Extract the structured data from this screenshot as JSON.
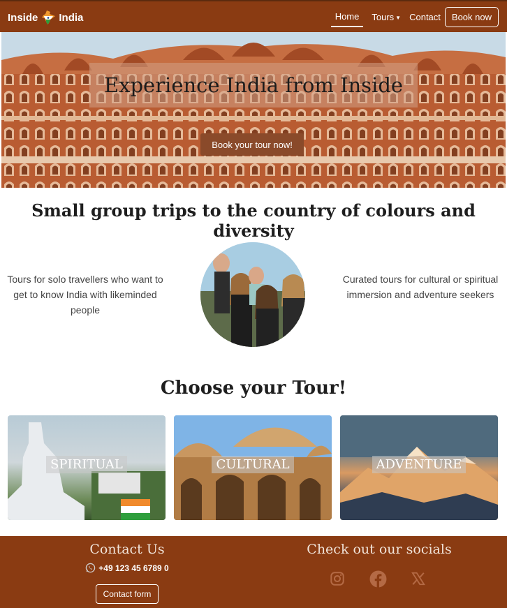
{
  "nav": {
    "brand_left": "Inside",
    "brand_right": "India",
    "links": [
      {
        "label": "Home"
      },
      {
        "label": "Tours"
      },
      {
        "label": "Contact"
      }
    ],
    "book_label": "Book now"
  },
  "hero": {
    "title": "Experience India from Inside",
    "cta": "Book your tour now!"
  },
  "intro": {
    "heading": "Small group trips to the country of colours and diversity",
    "left_text": "Tours for solo travellers who want to get to know India with likeminded people",
    "right_text": "Curated tours for cultural or spiritual immersion and adventure seekers"
  },
  "tours": {
    "heading": "Choose your Tour!",
    "cards": [
      {
        "label": "SPIRITUAL"
      },
      {
        "label": "CULTURAL"
      },
      {
        "label": "ADVENTURE"
      }
    ]
  },
  "footer": {
    "contact_title": "Contact Us",
    "phone": "+49 123 45 6789 0",
    "contact_button": "Contact form",
    "social_title": "Check out our socials",
    "socials": [
      "instagram-icon",
      "facebook-icon",
      "x-icon"
    ]
  },
  "colors": {
    "brand": "#8a3b12",
    "button_bg": "#8a4a2a",
    "social_icon": "#b46a45"
  }
}
